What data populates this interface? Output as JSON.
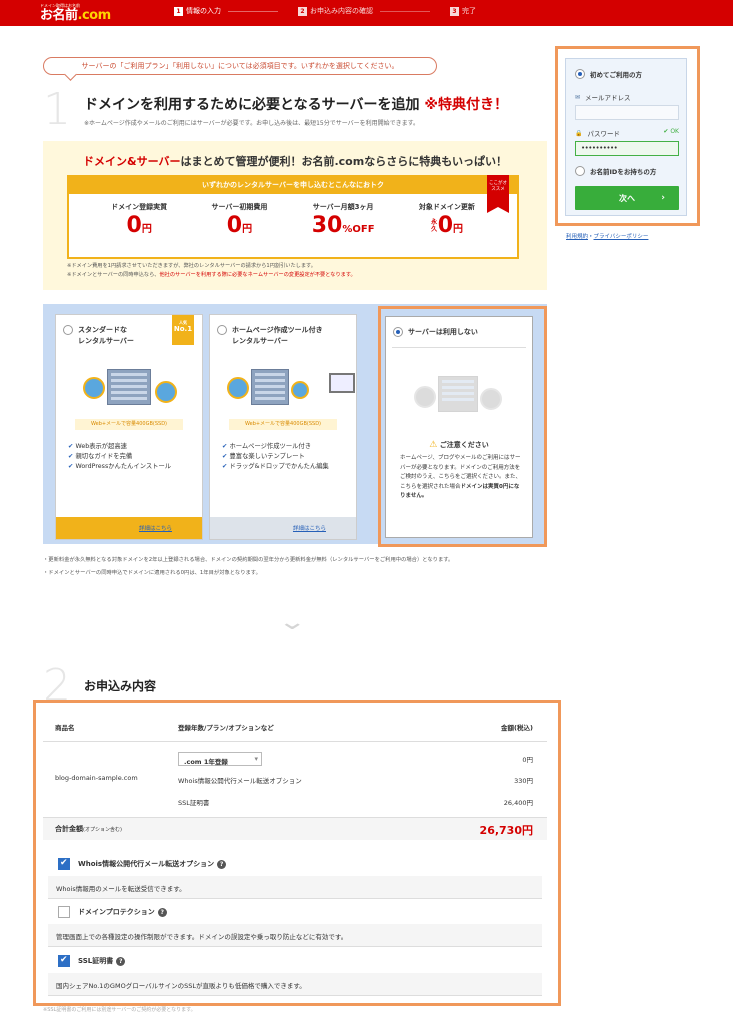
{
  "header": {
    "logo_small": "ドメイン取得はお名前",
    "logo_main_left": "お名前",
    "logo_main_right": ".com",
    "steps": [
      {
        "num": "1",
        "label": "情報の入力"
      },
      {
        "num": "2",
        "label": "お申込み内容の確認"
      },
      {
        "num": "3",
        "label": "完了"
      }
    ]
  },
  "notice": "サーバーの「ご利用プラン」「利用しない」については必須項目です。いずれかを選択してください。",
  "section1": {
    "number": "1",
    "title": "ドメインを利用するために必要となるサーバーを追加",
    "title_accent": "※特典付き！",
    "subtitle": "※ホームページ作成やメールのご利用にはサーバーが必要です。お申し込み後は、最短15分でサーバーを利用開始できます。"
  },
  "promo": {
    "headline_a": "ドメイン&サーバー",
    "headline_b": "はまとめて管理が便利！",
    "headline_c": "お名前.comならさらに特典もいっぱい！",
    "box_title": "いずれかのレンタルサーバーを申し込むとこんなにおトク",
    "ribbon": "ここがオススメ",
    "items": [
      {
        "label": "ドメイン登録実質",
        "value": "0",
        "unit": "円"
      },
      {
        "label": "サーバー初期費用",
        "value": "0",
        "unit": "円"
      },
      {
        "label": "サーバー月額3ヶ月",
        "value": "30",
        "unit": "%OFF"
      },
      {
        "label": "対象ドメイン更新",
        "value": "0",
        "unit": "円",
        "prefix": "永久"
      }
    ],
    "note1": "※ドメイン費用を1円請求させていただきますが、弊社のレンタルサーバーの請求から1円割引いたします。",
    "note2a": "※ドメインとサーバーの同時申込なら、",
    "note2b": "他社のサーバーを利用する際に必要なネームサーバーの変更設定が不要となります。"
  },
  "plans": [
    {
      "title": "スタンダードな\nレンタルサーバー",
      "badge_small": "人気",
      "badge_big": "No.1",
      "tag": "Web+メールで容量400GB(SSD)",
      "features": [
        "Web表示が超高速",
        "親切なガイドを完備",
        "WordPressかんたんインストール"
      ],
      "link": "詳細はこちら"
    },
    {
      "title": "ホームページ作成ツール付き\nレンタルサーバー",
      "tag": "Web+メールで容量400GB(SSD)",
      "features": [
        "ホームページ作成ツール付き",
        "豊富な楽しいテンプレート",
        "ドラッグ&ドロップでかんたん編集"
      ],
      "link": "詳細はこちら"
    },
    {
      "title": "サーバーは利用しない",
      "caution_title": "ご注意ください",
      "caution_text": "ホームページ、ブログやメールのご利用にはサーバーが必要となります。ドメインのご利用方法をご検討のうえ、こちらをご選択ください。また、こちらを選択された場合",
      "caution_bold": "ドメインは実質0円になりません。"
    }
  ],
  "foot_notes": [
    "・更新料金が永久無料となる対象ドメインを2年以上登録される場合、ドメインの契約期間の翌年分から更新料金が無料（レンタルサーバーをご利用中の場合）となります。",
    "・ドメインとサーバーの同時申込でドメインに適用される0円は、1年目が対象となります。"
  ],
  "section2": {
    "number": "2",
    "title": "お申込み内容",
    "col_product": "商品名",
    "col_plan": "登録年数/プラン/オプションなど",
    "col_price": "金額(税込)",
    "domain": "blog-domain-sample.com",
    "select_value": ".com 1年登録",
    "lines": [
      {
        "name": "",
        "price": "0円"
      },
      {
        "name": "Whois情報公開代行メール転送オプション",
        "price": "330円"
      },
      {
        "name": "SSL証明書",
        "price": "26,400円"
      }
    ],
    "total_label": "合計金額",
    "total_sub": "(オプション含む)",
    "total_value": "26,730円",
    "options": [
      {
        "label": "Whois情報公開代行メール転送オプション",
        "checked": true,
        "desc": "Whois情報用のメールを転送受信できます。"
      },
      {
        "label": "ドメインプロテクション",
        "checked": false,
        "desc": "管理画面上での各種設定の操作制限ができます。ドメインの誤設定や乗っ取り防止などに有効です。"
      },
      {
        "label": "SSL証明書",
        "checked": true,
        "desc": "国内シェアNo.1のGMOグローバルサインのSSLが直販よりも低価格で購入できます。"
      }
    ],
    "cut_text": "※SSL証明書のご利用には別途サーバーのご契約が必要となります。"
  },
  "login": {
    "first_time": "初めてご利用の方",
    "email_label": "メールアドレス",
    "password_label": "パスワード",
    "password_value": "••••••••••",
    "pw_ok": "OK",
    "has_id": "お名前IDをお持ちの方",
    "next": "次へ",
    "next_arrow": "›",
    "terms": "利用規約",
    "privacy": "プライバシーポリシー",
    "sep": "・"
  },
  "colors": {
    "brand_red": "#d40000",
    "accent_yellow": "#f1b21a",
    "highlight_orange": "#f0985a",
    "next_green": "#38ad3b",
    "plan_bg_blue": "#c7daf3"
  }
}
